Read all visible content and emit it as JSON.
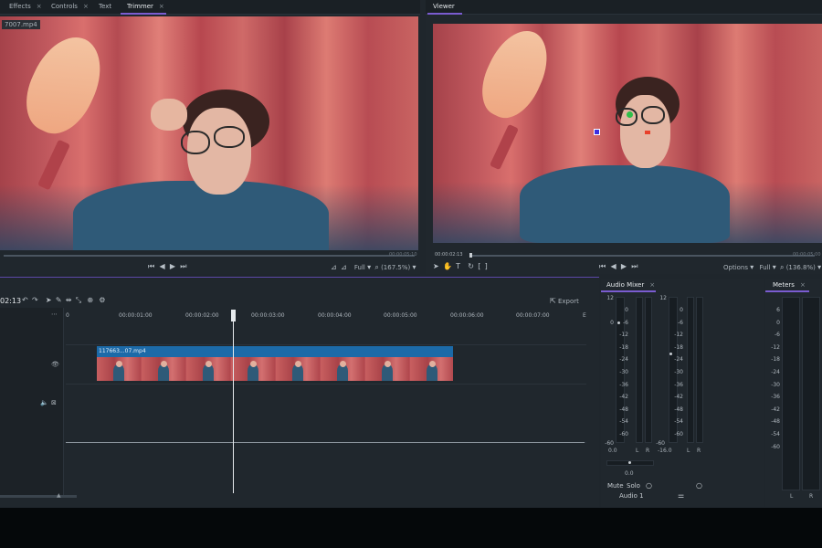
{
  "left_panel": {
    "tabs": [
      {
        "label": "Effects",
        "close": "×"
      },
      {
        "label": "Controls",
        "close": "×"
      },
      {
        "label": "Text",
        "close": ""
      },
      {
        "label": "Trimmer",
        "close": "×"
      }
    ],
    "filename": "7007.mp4",
    "timecode_end": "00:00:05:10",
    "zoom_mode": "Full",
    "zoom_level": "(167.5%)"
  },
  "right_panel": {
    "tab": "Viewer",
    "timecode_current": "00:00:02:13",
    "timecode_end": "00:00:05:00",
    "options_label": "Options",
    "zoom_mode": "Full",
    "zoom_level": "(136.8%)"
  },
  "timeline": {
    "timecode": "02:13",
    "export_label": "Export",
    "ruler_start": "0",
    "ruler_end": "E",
    "ruler_ticks": [
      "00:00:01:00",
      "00:00:02:00",
      "00:00:03:00",
      "00:00:04:00",
      "00:00:05:00",
      "00:00:06:00",
      "00:00:07:00"
    ],
    "clip_name": "117663...07.mp4",
    "playhead_fraction": 0.33
  },
  "audio_mixer": {
    "tab": "Audio Mixer",
    "close": "×",
    "top_scale": "12",
    "scale": [
      "0",
      "-6",
      "-12",
      "-18",
      "-24",
      "-30",
      "-36",
      "-42",
      "-48",
      "-54",
      "-60"
    ],
    "left_values": {
      "left": "0.0",
      "l": "L",
      "r": "R"
    },
    "right_values": {
      "left": "-16.0",
      "l": "L",
      "r": "R"
    },
    "left_bottom": "-60",
    "right_bottom": "-60",
    "pan_value": "0.0",
    "mute_label": "Mute",
    "solo_label": "Solo",
    "track_label": "Audio 1"
  },
  "meters": {
    "tab": "Meters",
    "close": "×",
    "scale": [
      "6",
      "0",
      "-6",
      "-12",
      "-18",
      "-24",
      "-30",
      "-36",
      "-42",
      "-48",
      "-54",
      "-60"
    ],
    "l": "L",
    "r": "R"
  }
}
